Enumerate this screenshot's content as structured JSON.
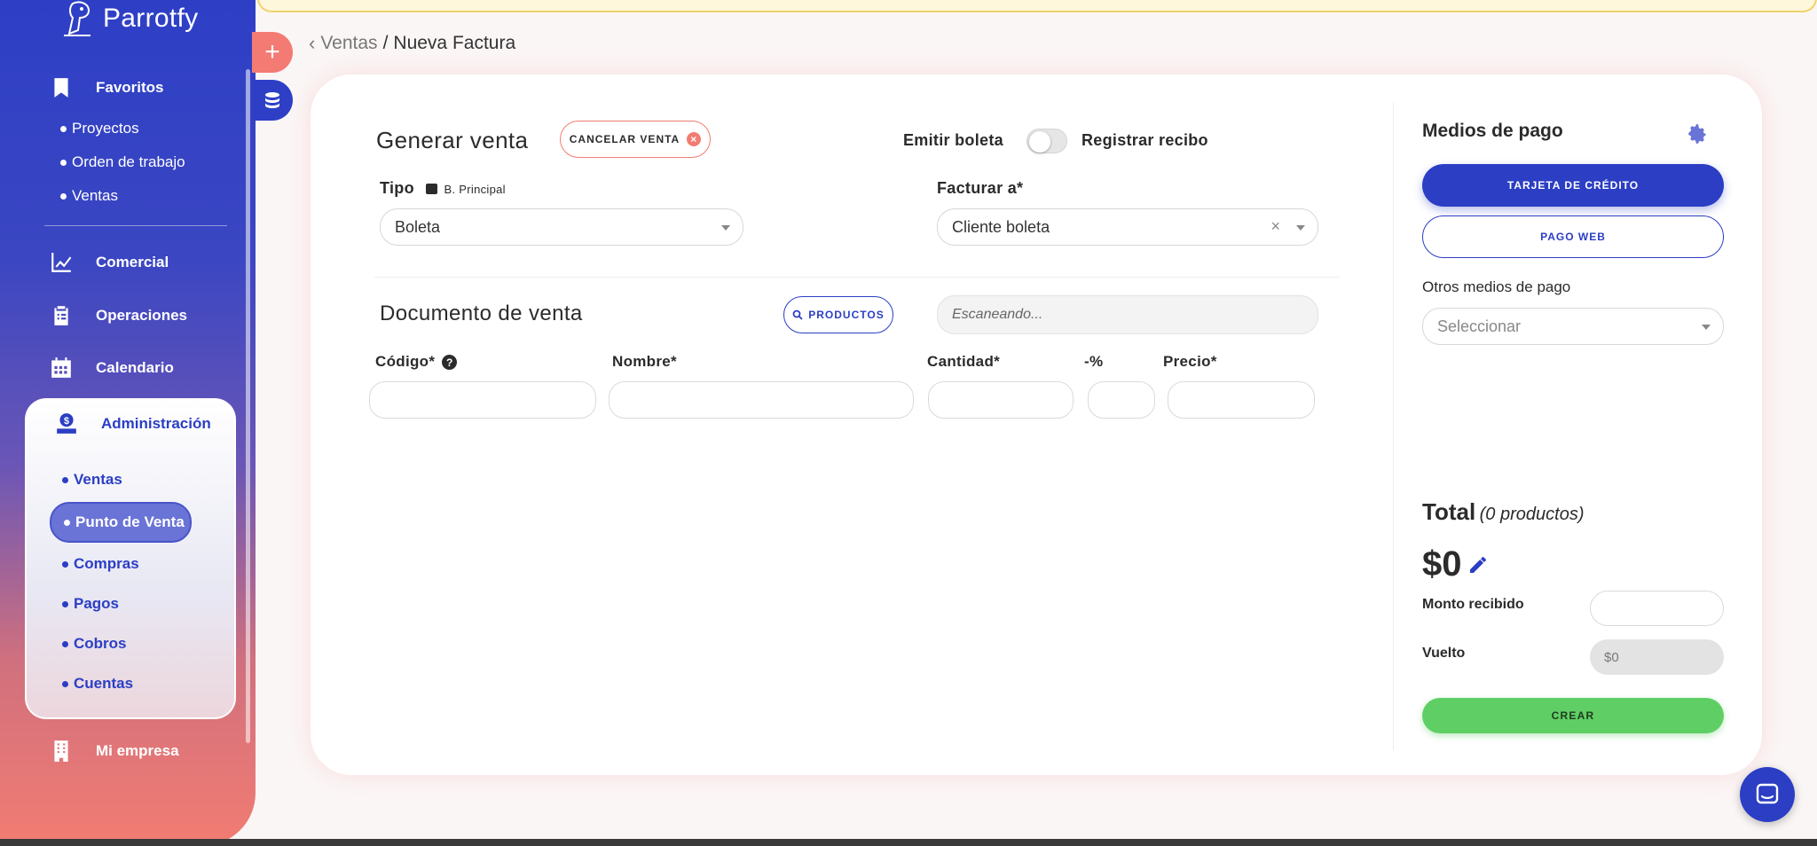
{
  "brand": {
    "name": "Parrotfy"
  },
  "sidebar": {
    "favoritos": {
      "label": "Favoritos",
      "items": [
        "Proyectos",
        "Orden de trabajo",
        "Ventas"
      ]
    },
    "comercial": "Comercial",
    "operaciones": "Operaciones",
    "calendario": "Calendario",
    "administracion": {
      "label": "Administración",
      "items": [
        "Ventas",
        "Punto de Venta",
        "Compras",
        "Pagos",
        "Cobros",
        "Cuentas"
      ],
      "active": "Punto de Venta"
    },
    "mi_empresa": "Mi empresa"
  },
  "breadcrumb": {
    "back": "Ventas",
    "separator": "/",
    "current": "Nueva Factura"
  },
  "venta": {
    "title": "Generar venta",
    "cancel_label": "CANCELAR VENTA",
    "emitir_label": "Emitir boleta",
    "registrar_label": "Registrar recibo",
    "tipo_label": "Tipo",
    "branch_label": "B. Principal",
    "tipo_value": "Boleta",
    "facturar_label": "Facturar a*",
    "facturar_value": "Cliente boleta",
    "clear_symbol": "×"
  },
  "documento": {
    "title": "Documento de venta",
    "productos_label": "PRODUCTOS",
    "scan_placeholder": "Escaneando...",
    "columns": {
      "codigo": "Código*",
      "nombre": "Nombre*",
      "cantidad": "Cantidad*",
      "descuento": "-%",
      "precio": "Precio*"
    }
  },
  "pago": {
    "title": "Medios de pago",
    "tarjeta_label": "TARJETA DE CRÉDITO",
    "web_label": "PAGO WEB",
    "otros_label": "Otros medios de pago",
    "otros_placeholder": "Seleccionar"
  },
  "total": {
    "label": "Total",
    "count": "(0 productos)",
    "amount": "$0",
    "monto_label": "Monto recibido",
    "vuelto_label": "Vuelto",
    "vuelto_value": "$0",
    "crear_label": "CREAR"
  },
  "colors": {
    "primary": "#2b3ec4",
    "accent": "#f27c72",
    "success": "#5fcf65"
  }
}
